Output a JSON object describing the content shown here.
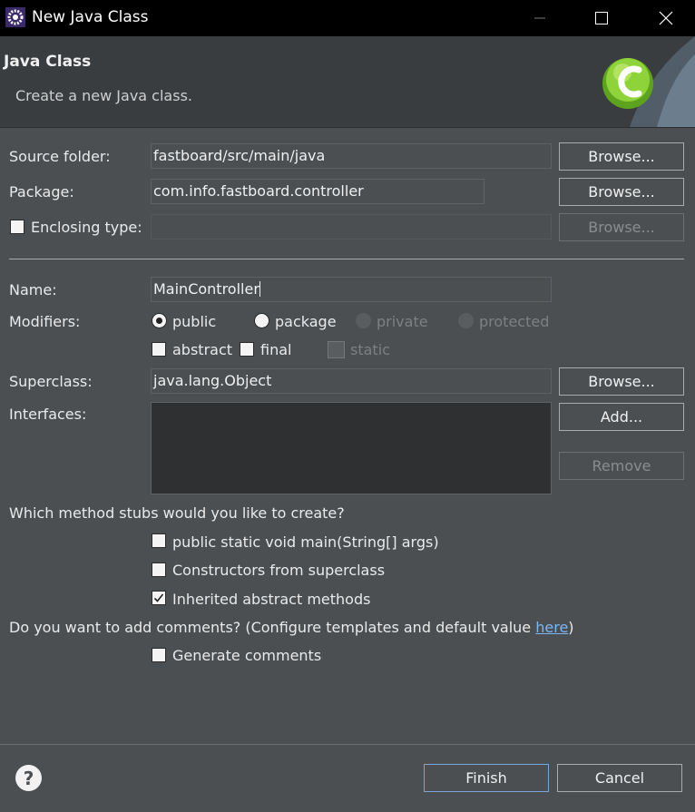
{
  "window": {
    "title": "New Java Class"
  },
  "header": {
    "title": "Java Class",
    "description": "Create a new Java class."
  },
  "source_folder": {
    "label": "Source folder:",
    "value": "fastboard/src/main/java",
    "browse": "Browse..."
  },
  "package": {
    "label": "Package:",
    "value": "com.info.fastboard.controller",
    "browse": "Browse..."
  },
  "enclosing_type": {
    "label": "Enclosing type:",
    "value": "",
    "checked": false,
    "browse": "Browse..."
  },
  "name": {
    "label": "Name:",
    "value": "MainController"
  },
  "modifiers": {
    "label": "Modifiers:",
    "access": [
      {
        "label": "public",
        "selected": true,
        "enabled": true
      },
      {
        "label": "package",
        "selected": false,
        "enabled": true
      },
      {
        "label": "private",
        "selected": false,
        "enabled": false
      },
      {
        "label": "protected",
        "selected": false,
        "enabled": false
      }
    ],
    "flags": [
      {
        "label": "abstract",
        "checked": false,
        "enabled": true
      },
      {
        "label": "final",
        "checked": false,
        "enabled": true
      },
      {
        "label": "static",
        "checked": false,
        "enabled": false
      }
    ]
  },
  "superclass": {
    "label": "Superclass:",
    "value": "java.lang.Object",
    "browse": "Browse..."
  },
  "interfaces": {
    "label": "Interfaces:",
    "add": "Add...",
    "remove": "Remove"
  },
  "stubs": {
    "question": "Which method stubs would you like to create?",
    "options": [
      {
        "label": "public static void main(String[] args)",
        "checked": false
      },
      {
        "label": "Constructors from superclass",
        "checked": false
      },
      {
        "label": "Inherited abstract methods",
        "checked": true
      }
    ]
  },
  "comments": {
    "question": "Do you want to add comments? (Configure templates and default value ",
    "link": "here",
    "close": ")",
    "option": {
      "label": "Generate comments",
      "checked": false
    }
  },
  "footer": {
    "help": "?",
    "finish": "Finish",
    "cancel": "Cancel"
  }
}
